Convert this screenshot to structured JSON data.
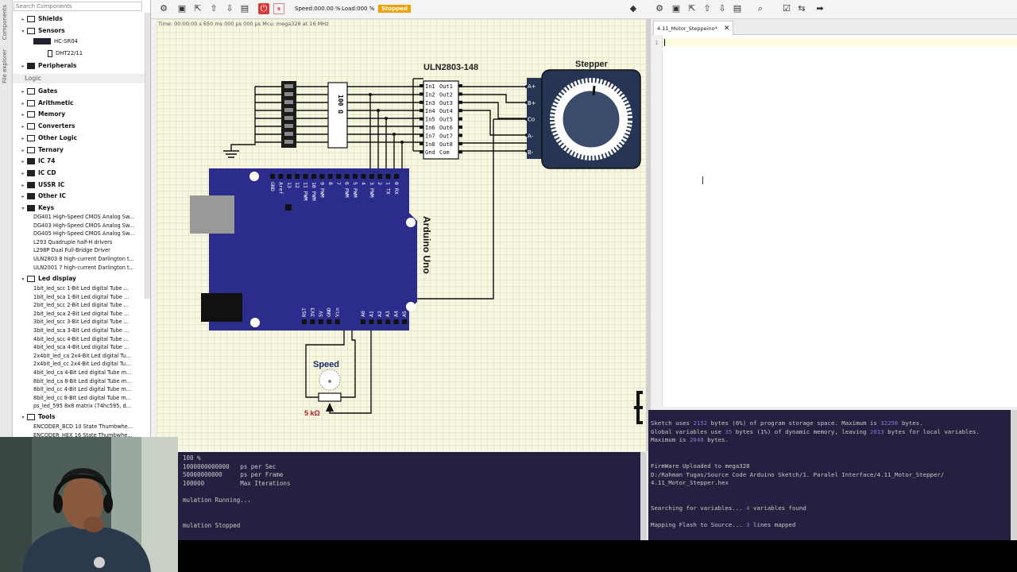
{
  "sidebar": {
    "tabs": [
      "Components",
      "File explorer"
    ],
    "search_placeholder": "Search Components",
    "items": [
      {
        "label": "Shields",
        "kind": "cat"
      },
      {
        "label": "Sensors",
        "kind": "cat"
      },
      {
        "label": "HC-SR04",
        "kind": "leaf"
      },
      {
        "label": "DHT22/11",
        "kind": "leaf"
      },
      {
        "label": "Peripherals",
        "kind": "cat"
      }
    ],
    "logic_header": "Logic",
    "logic_items": [
      "Gates",
      "Arithmetic",
      "Memory",
      "Converters",
      "Other Logic",
      "Ternary",
      "IC 74",
      "IC CD",
      "USSR IC",
      "Other IC",
      "Keys"
    ],
    "key_items": [
      "DG401  High-Speed CMOS Analog Sw...",
      "DG403  High-Speed CMOS Analog Sw...",
      "DG405  High-Speed CMOS Analog Sw...",
      "L293  Quadruple half-H drivers",
      "L298P  Dual Full-Bridge Driver",
      "ULN2803  8 high-current Darlington t...",
      "ULN2001  7 high-current Darlington t..."
    ],
    "led_header": "Led display",
    "led_items": [
      "1bit_led_scc  1-Bit Led digital Tube ...",
      "1bit_led_sca  1-Bit Led digital Tube ...",
      "2bit_led_scc  2-Bit Led digital Tube ...",
      "2bit_led_sca  2-Bit Led digital Tube ...",
      "3bit_led_scc  3-Bit Led digital Tube ...",
      "3bit_led_sca  3-Bit Led digital Tube ...",
      "4bit_led_scc  4-Bit Led digital Tube ...",
      "4bit_led_sca  4-Bit Led digital Tube ...",
      "2x4bit_led_ca  2x4-Bit Led digital Tu...",
      "2x4bit_led_cc  2x4-Bit Led digital Tu...",
      "4bit_led_ca  4-Bit Led digital Tube m...",
      "8bit_led_ca  8-Bit Led digital Tube m...",
      "8bit_led_cc  4-Bit Led digital Tube m...",
      "8bit_led_cc  8-Bit Led digital Tube m...",
      "ps_led_595  8x8 matrix (74hc595, d..."
    ],
    "tools_header": "Tools",
    "tool_items": [
      "ENCODER_BCD  10 State Thumbwhe...",
      "ENCODER_HEX  16 State Thumbwhe..."
    ]
  },
  "toolbar": {
    "speed": "Speed:000.00 %",
    "load": "Load:000 %",
    "status": "Stopped",
    "status_color": "#f0a000",
    "icons": [
      "gear-icon",
      "open-icon",
      "export-icon",
      "upload-icon",
      "save-icon",
      "delete-icon",
      "power-icon",
      "pause-icon"
    ]
  },
  "canvas": {
    "time_info": "Time: 00:00:00 s  650 ms  000 ps  000 ps     Mcu: mega328 at 16 MHz",
    "resistor_label": "100 Ω",
    "uln_title": "ULN2803-148",
    "uln_inputs": [
      "In1",
      "In2",
      "In3",
      "In4",
      "In5",
      "In6",
      "In7",
      "In8",
      "Gnd"
    ],
    "uln_outputs": [
      "Out1",
      "Out2",
      "Out3",
      "Out4",
      "Out5",
      "Out6",
      "Out7",
      "Out8",
      "Com"
    ],
    "stepper_title": "Stepper",
    "stepper_pins": [
      "A+",
      "B+",
      "Co",
      "A-",
      "B-"
    ],
    "arduino_label": "Arduino Uno",
    "arduino_top_pins": [
      "GND",
      "Aref",
      "13",
      "12",
      "11 PWM",
      "10 PWM",
      "9 PWM",
      "8",
      "7",
      "6 PWM",
      "5 PWM",
      "4",
      "3 PWM",
      "2",
      "1 TX",
      "0 RX"
    ],
    "arduino_bottom_pins": [
      "RST",
      "3V3",
      "5V",
      "GND",
      "Vin",
      "A0",
      "A1",
      "A2",
      "A3",
      "A4",
      "A5"
    ],
    "speed_label": "Speed",
    "pot_value": "5 kΩ",
    "board_color": "#2c2c8c"
  },
  "editor": {
    "toolbar_icons": [
      "gear-icon",
      "open-icon",
      "export-icon",
      "upload-icon",
      "save-icon",
      "new-icon",
      "search-icon",
      "check-icon",
      "compile-icon",
      "upload-arrow-icon"
    ],
    "tab_label": "4.11_Motor_Steppeino*",
    "line_number": "1"
  },
  "console_left": {
    "lines": [
      "100 %",
      "1000000000000   ps per Sec",
      "50000000000     ps per Frame",
      "100000          Max Iterations",
      "",
      "mulation Running...",
      "",
      "",
      "mulation Stopped"
    ]
  },
  "console_right": {
    "line1_pre": "Sketch uses ",
    "line1_v1": "2152",
    "line1_mid": " bytes (6%) of program storage space. Maximum is ",
    "line1_v2": "32256",
    "line1_post": " bytes.",
    "line2_pre": "Global variables use ",
    "line2_v1": "35",
    "line2_mid": " bytes (1%) of dynamic memory, leaving ",
    "line2_v2": "2013",
    "line2_post": " bytes for local variables.",
    "line3_pre": "Maximum is ",
    "line3_v1": "2048",
    "line3_post": " bytes.",
    "fw": "FirmWare Uploaded to mega328",
    "path1": "D:/Rahman Tugas/Source Code Arduino Sketch/1. Paralel Interface/4.11_Motor_Stepper/",
    "path2": "4.11_Motor_Stepper.hex",
    "search_pre": "Searching for variables... ",
    "search_v": "4",
    "search_post": " variables found",
    "map_pre": "Mapping Flash to Source... ",
    "map_v": "3",
    "map_post": " lines mapped"
  }
}
